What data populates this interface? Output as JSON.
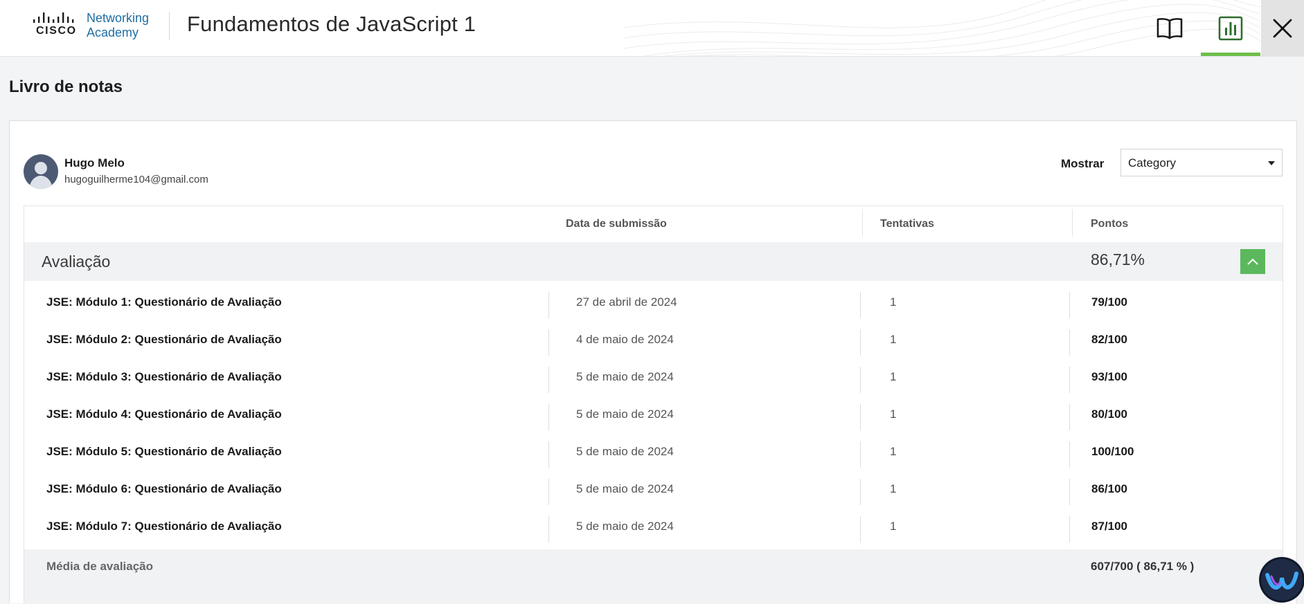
{
  "header": {
    "logo_brand": "CISCO",
    "logo_line1": "Networking",
    "logo_line2": "Academy",
    "course_title": "Fundamentos de JavaScript 1",
    "icons": [
      "book-icon",
      "bar-chart-icon",
      "close-icon"
    ],
    "active_tab_color": "#6ebe4a"
  },
  "page": {
    "title": "Livro de notas"
  },
  "user": {
    "name": "Hugo Melo",
    "email": "hugoguilherme104@gmail.com"
  },
  "filter": {
    "label": "Mostrar",
    "selected": "Category"
  },
  "table": {
    "headers": {
      "date": "Data de submissão",
      "attempts": "Tentativas",
      "points": "Pontos"
    },
    "category": {
      "name": "Avaliação",
      "score": "86,71%",
      "toggle_color": "#5cb85c"
    },
    "rows": [
      {
        "name": "JSE: Módulo 1: Questionário de Avaliação",
        "date": "27 de abril de 2024",
        "attempts": "1",
        "points": "79/100"
      },
      {
        "name": "JSE: Módulo 2: Questionário de Avaliação",
        "date": "4 de maio de 2024",
        "attempts": "1",
        "points": "82/100"
      },
      {
        "name": "JSE: Módulo 3: Questionário de Avaliação",
        "date": "5 de maio de 2024",
        "attempts": "1",
        "points": "93/100"
      },
      {
        "name": "JSE: Módulo 4: Questionário de Avaliação",
        "date": "5 de maio de 2024",
        "attempts": "1",
        "points": "80/100"
      },
      {
        "name": "JSE: Módulo 5: Questionário de Avaliação",
        "date": "5 de maio de 2024",
        "attempts": "1",
        "points": "100/100"
      },
      {
        "name": "JSE: Módulo 6: Questionário de Avaliação",
        "date": "5 de maio de 2024",
        "attempts": "1",
        "points": "86/100"
      },
      {
        "name": "JSE: Módulo 7: Questionário de Avaliação",
        "date": "5 de maio de 2024",
        "attempts": "1",
        "points": "87/100"
      }
    ],
    "footer": {
      "label": "Média de avaliação",
      "value": "607/700 ( 86,71 % )"
    }
  }
}
